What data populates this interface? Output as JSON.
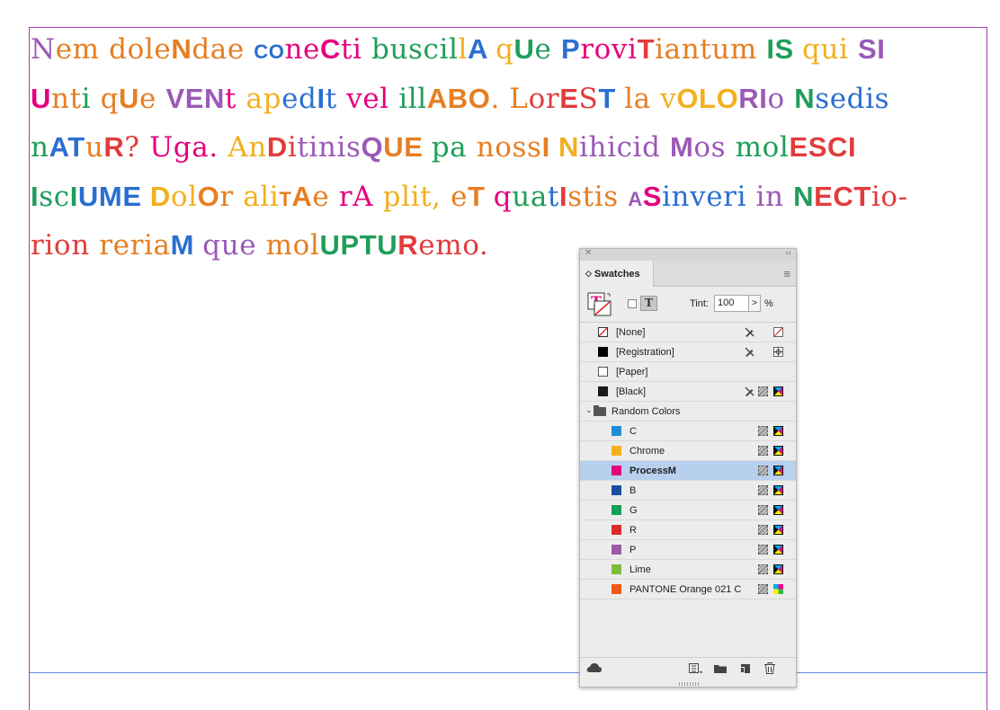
{
  "document": {
    "lines": [
      [
        {
          "t": "N",
          "c": "#9b59b6",
          "k": "s"
        },
        {
          "t": "em ",
          "c": "#e67e22",
          "k": "s"
        },
        {
          "t": "dole",
          "c": "#e67e22",
          "k": "s"
        },
        {
          "t": "N",
          "c": "#e67e22",
          "k": "c"
        },
        {
          "t": "dae ",
          "c": "#e67e22",
          "k": "s"
        },
        {
          "t": "co",
          "c": "#2a6fd1",
          "k": "c"
        },
        {
          "t": "ne",
          "c": "#e6007e",
          "k": "s"
        },
        {
          "t": "C",
          "c": "#e6007e",
          "k": "c"
        },
        {
          "t": "ti ",
          "c": "#e6007e",
          "k": "s"
        },
        {
          "t": "buscil",
          "c": "#1f9e5a",
          "k": "s"
        },
        {
          "t": "l",
          "c": "#f2b01e",
          "k": "s"
        },
        {
          "t": "A ",
          "c": "#2a6fd1",
          "k": "c"
        },
        {
          "t": "q",
          "c": "#f2b01e",
          "k": "s"
        },
        {
          "t": "U",
          "c": "#1f9e5a",
          "k": "c"
        },
        {
          "t": "e ",
          "c": "#1f9e5a",
          "k": "s"
        },
        {
          "t": "P",
          "c": "#2a6fd1",
          "k": "c"
        },
        {
          "t": "r",
          "c": "#e6007e",
          "k": "s"
        },
        {
          "t": "ovi",
          "c": "#e6007e",
          "k": "s"
        },
        {
          "t": "T",
          "c": "#e23b3b",
          "k": "c"
        },
        {
          "t": "iantum ",
          "c": "#e67e22",
          "k": "s"
        },
        {
          "t": "IS ",
          "c": "#1f9e5a",
          "k": "c"
        },
        {
          "t": "qui ",
          "c": "#f2b01e",
          "k": "s"
        },
        {
          "t": "SI",
          "c": "#9b59b6",
          "k": "c"
        }
      ],
      [
        {
          "t": "U",
          "c": "#e6007e",
          "k": "c"
        },
        {
          "t": "nt",
          "c": "#e67e22",
          "k": "s"
        },
        {
          "t": "i ",
          "c": "#1f9e5a",
          "k": "s"
        },
        {
          "t": "q",
          "c": "#e67e22",
          "k": "s"
        },
        {
          "t": "U",
          "c": "#e67e22",
          "k": "c"
        },
        {
          "t": "e ",
          "c": "#e67e22",
          "k": "s"
        },
        {
          "t": "VE",
          "c": "#9b59b6",
          "k": "c"
        },
        {
          "t": "N",
          "c": "#9b59b6",
          "k": "c"
        },
        {
          "t": "t ",
          "c": "#e6007e",
          "k": "s"
        },
        {
          "t": "a",
          "c": "#f2b01e",
          "k": "s"
        },
        {
          "t": "p",
          "c": "#f2b01e",
          "k": "s"
        },
        {
          "t": "ed",
          "c": "#2a6fd1",
          "k": "s"
        },
        {
          "t": "I",
          "c": "#2a6fd1",
          "k": "c"
        },
        {
          "t": "t ",
          "c": "#2a6fd1",
          "k": "s"
        },
        {
          "t": "vel ",
          "c": "#e6007e",
          "k": "s"
        },
        {
          "t": "ill",
          "c": "#1f9e5a",
          "k": "s"
        },
        {
          "t": "ABO",
          "c": "#e67e22",
          "k": "c"
        },
        {
          "t": ". ",
          "c": "#e67e22",
          "k": "s"
        },
        {
          "t": "L",
          "c": "#e67e22",
          "k": "s"
        },
        {
          "t": "or",
          "c": "#e23b3b",
          "k": "s"
        },
        {
          "t": "E",
          "c": "#e23b3b",
          "k": "c"
        },
        {
          "t": "S",
          "c": "#e23b3b",
          "k": "s"
        },
        {
          "t": "T ",
          "c": "#2a6fd1",
          "k": "c"
        },
        {
          "t": "la ",
          "c": "#e67e22",
          "k": "s"
        },
        {
          "t": "v",
          "c": "#f2b01e",
          "k": "s"
        },
        {
          "t": "OLO",
          "c": "#f2b01e",
          "k": "c"
        },
        {
          "t": "RI",
          "c": "#9b59b6",
          "k": "c"
        },
        {
          "t": "o ",
          "c": "#9b59b6",
          "k": "s"
        },
        {
          "t": "N",
          "c": "#1f9e5a",
          "k": "c"
        },
        {
          "t": "sedis",
          "c": "#2a6fd1",
          "k": "s"
        }
      ],
      [
        {
          "t": "n",
          "c": "#1f9e5a",
          "k": "s"
        },
        {
          "t": "AT",
          "c": "#2a6fd1",
          "k": "c"
        },
        {
          "t": "u",
          "c": "#e67e22",
          "k": "s"
        },
        {
          "t": "R",
          "c": "#e23b3b",
          "k": "c"
        },
        {
          "t": "? ",
          "c": "#e23b3b",
          "k": "s"
        },
        {
          "t": "Uga",
          "c": "#e6007e",
          "k": "s"
        },
        {
          "t": ". ",
          "c": "#e6007e",
          "k": "s"
        },
        {
          "t": "An",
          "c": "#f2b01e",
          "k": "s"
        },
        {
          "t": "D",
          "c": "#e23b3b",
          "k": "c"
        },
        {
          "t": "i",
          "c": "#e23b3b",
          "k": "s"
        },
        {
          "t": "tinis",
          "c": "#9b59b6",
          "k": "s"
        },
        {
          "t": "Q",
          "c": "#9b59b6",
          "k": "c"
        },
        {
          "t": "UE ",
          "c": "#e67e22",
          "k": "c"
        },
        {
          "t": "pa ",
          "c": "#1f9e5a",
          "k": "s"
        },
        {
          "t": "noss",
          "c": "#e67e22",
          "k": "s"
        },
        {
          "t": "I ",
          "c": "#e67e22",
          "k": "c"
        },
        {
          "t": "N",
          "c": "#f2b01e",
          "k": "c"
        },
        {
          "t": "ihici",
          "c": "#9b59b6",
          "k": "s"
        },
        {
          "t": "d ",
          "c": "#9b59b6",
          "k": "s"
        },
        {
          "t": "M",
          "c": "#9b59b6",
          "k": "c"
        },
        {
          "t": "os ",
          "c": "#9b59b6",
          "k": "s"
        },
        {
          "t": "mol",
          "c": "#1f9e5a",
          "k": "s"
        },
        {
          "t": "ESCI",
          "c": "#e23b3b",
          "k": "c"
        }
      ],
      [
        {
          "t": "I",
          "c": "#1f9e5a",
          "k": "c"
        },
        {
          "t": "sc",
          "c": "#1f9e5a",
          "k": "s"
        },
        {
          "t": "I",
          "c": "#1f9e5a",
          "k": "c"
        },
        {
          "t": "UME ",
          "c": "#2a6fd1",
          "k": "c"
        },
        {
          "t": "D",
          "c": "#f2b01e",
          "k": "c"
        },
        {
          "t": "ol",
          "c": "#f2b01e",
          "k": "s"
        },
        {
          "t": "O",
          "c": "#e67e22",
          "k": "c"
        },
        {
          "t": "r ",
          "c": "#e67e22",
          "k": "s"
        },
        {
          "t": "ali",
          "c": "#f2b01e",
          "k": "s"
        },
        {
          "t": "tA",
          "c": "#e67e22",
          "k": "c"
        },
        {
          "t": "e ",
          "c": "#e67e22",
          "k": "s"
        },
        {
          "t": "rA ",
          "c": "#e6007e",
          "k": "s"
        },
        {
          "t": "plit, ",
          "c": "#f2b01e",
          "k": "s"
        },
        {
          "t": "e",
          "c": "#e67e22",
          "k": "s"
        },
        {
          "t": "T ",
          "c": "#e67e22",
          "k": "c"
        },
        {
          "t": "q",
          "c": "#e6007e",
          "k": "s"
        },
        {
          "t": "ua",
          "c": "#1f9e5a",
          "k": "s"
        },
        {
          "t": "t",
          "c": "#2a6fd1",
          "k": "s"
        },
        {
          "t": "I",
          "c": "#e23b3b",
          "k": "c"
        },
        {
          "t": "stis ",
          "c": "#e67e22",
          "k": "s"
        },
        {
          "t": "a",
          "c": "#9b59b6",
          "k": "c"
        },
        {
          "t": "S",
          "c": "#e6007e",
          "k": "c"
        },
        {
          "t": "inveri ",
          "c": "#2a6fd1",
          "k": "s"
        },
        {
          "t": "in ",
          "c": "#9b59b6",
          "k": "s"
        },
        {
          "t": "N",
          "c": "#1f9e5a",
          "k": "c"
        },
        {
          "t": "E",
          "c": "#e23b3b",
          "k": "c"
        },
        {
          "t": "CT",
          "c": "#e23b3b",
          "k": "c"
        },
        {
          "t": "io-",
          "c": "#e23b3b",
          "k": "s"
        }
      ],
      [
        {
          "t": "rion ",
          "c": "#e23b3b",
          "k": "s"
        },
        {
          "t": "r",
          "c": "#e67e22",
          "k": "s"
        },
        {
          "t": "eria",
          "c": "#e67e22",
          "k": "s"
        },
        {
          "t": "M ",
          "c": "#2a6fd1",
          "k": "c"
        },
        {
          "t": "que ",
          "c": "#9b59b6",
          "k": "s"
        },
        {
          "t": "mol",
          "c": "#e67e22",
          "k": "s"
        },
        {
          "t": "UPT",
          "c": "#1f9e5a",
          "k": "c"
        },
        {
          "t": "U",
          "c": "#1f9e5a",
          "k": "c"
        },
        {
          "t": "R",
          "c": "#e23b3b",
          "k": "c"
        },
        {
          "t": "emo.",
          "c": "#e23b3b",
          "k": "s"
        }
      ]
    ]
  },
  "panel": {
    "title": "Swatches",
    "tint_label": "Tint:",
    "tint_value": "100",
    "tint_unit": "%",
    "tint_arrow": ">",
    "formatting_text_label": "T",
    "top_swatches": [
      {
        "name": "[None]",
        "color": "none",
        "icons": [
          "pencil-cross-icon",
          "none-swatch-icon"
        ]
      },
      {
        "name": "[Registration]",
        "color": "#000000",
        "icons": [
          "pencil-cross-icon",
          "registration-icon"
        ]
      },
      {
        "name": "[Paper]",
        "color": "#ffffff",
        "icons": []
      },
      {
        "name": "[Black]",
        "color": "#1a1a1a",
        "icons": [
          "pencil-cross-icon",
          "process-icon",
          "cmyk-icon"
        ]
      }
    ],
    "group": {
      "name": "Random Colors",
      "expanded": true
    },
    "group_swatches": [
      {
        "name": "C",
        "color": "#1e8fd8",
        "selected": false,
        "mode": "cmyk"
      },
      {
        "name": "Chrome",
        "color": "#f5b01e",
        "selected": false,
        "mode": "cmyk"
      },
      {
        "name": "ProcessM",
        "color": "#e6007e",
        "selected": true,
        "mode": "cmyk"
      },
      {
        "name": "B",
        "color": "#1a4fa0",
        "selected": false,
        "mode": "cmyk"
      },
      {
        "name": "G",
        "color": "#159e55",
        "selected": false,
        "mode": "cmyk"
      },
      {
        "name": "R",
        "color": "#e02a2a",
        "selected": false,
        "mode": "cmyk"
      },
      {
        "name": "P",
        "color": "#9a5ba8",
        "selected": false,
        "mode": "cmyk"
      },
      {
        "name": "Lime",
        "color": "#7dbb3b",
        "selected": false,
        "mode": "cmyk"
      },
      {
        "name": "PANTONE Orange 021 C",
        "color": "#f05a14",
        "selected": false,
        "mode": "spot"
      }
    ]
  }
}
